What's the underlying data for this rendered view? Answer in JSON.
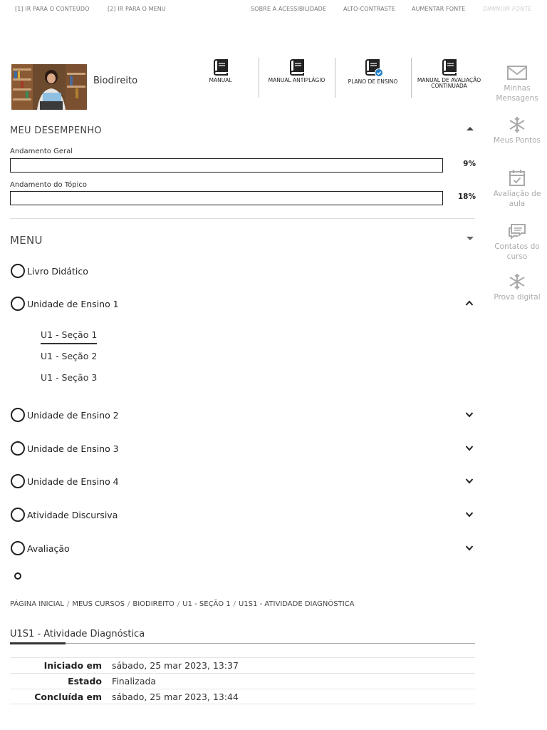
{
  "skip_links": [
    {
      "label": "[1] IR PARA O CONTEÚDO"
    },
    {
      "label": "[2] IR PARA O MENU"
    },
    {
      "label": "SOBRE A ACESSIBILIDADE"
    },
    {
      "label": "ALTO-CONTRASTE"
    },
    {
      "label": "AUMENTAR FONTE"
    },
    {
      "label": "DIMINUIR FONTE"
    }
  ],
  "course": {
    "title": "Biodireito"
  },
  "resources": [
    {
      "label": "MANUAL",
      "icon": "book-icon"
    },
    {
      "label": "MANUAL ANTIPLÁGIO",
      "icon": "book-icon"
    },
    {
      "label": "PLANO DE ENSINO",
      "icon": "book-check-icon"
    },
    {
      "label": "MANUAL DE AVALIAÇÃO CONTINUADA",
      "icon": "book-icon"
    }
  ],
  "sidenav": [
    {
      "label": "Minhas Mensagens",
      "icon": "envelope-icon"
    },
    {
      "label": "Meus Pontos",
      "icon": "snowflake-icon"
    },
    {
      "label": "Avaliação de aula",
      "icon": "calendar-check-icon"
    },
    {
      "label": "Contatos do curso",
      "icon": "chat-icon"
    },
    {
      "label": "Prova digital",
      "icon": "snowflake-icon"
    }
  ],
  "performance": {
    "title": "MEU DESEMPENHO",
    "items": [
      {
        "label": "Andamento Geral",
        "percent": 9,
        "percent_text": "9%"
      },
      {
        "label": "Andamento do Tópico",
        "percent": 18,
        "percent_text": "18%"
      }
    ]
  },
  "menu": {
    "title": "MENU",
    "items": [
      {
        "label": "Livro Didático",
        "expandable": false
      },
      {
        "label": "Unidade de Ensino 1",
        "expandable": true,
        "expanded": true
      },
      {
        "label": "Unidade de Ensino 2",
        "expandable": true,
        "expanded": false
      },
      {
        "label": "Unidade de Ensino 3",
        "expandable": true,
        "expanded": false
      },
      {
        "label": "Unidade de Ensino 4",
        "expandable": true,
        "expanded": false
      },
      {
        "label": "Atividade Discursiva",
        "expandable": true,
        "expanded": false
      },
      {
        "label": "Avaliação",
        "expandable": true,
        "expanded": false
      }
    ],
    "subitems": [
      {
        "label": "U1 - Seção 1",
        "active": true
      },
      {
        "label": "U1 - Seção 2",
        "active": false
      },
      {
        "label": "U1 - Seção 3",
        "active": false
      }
    ]
  },
  "breadcrumb": [
    "PÁGINA INICIAL",
    "MEUS CURSOS",
    "BIODIREITO",
    "U1 - SEÇÃO 1",
    "U1S1 - ATIVIDADE DIAGNÓSTICA"
  ],
  "activity": {
    "title": "U1S1 - Atividade Diagnóstica",
    "summary": [
      {
        "key": "Iniciado em",
        "value": "sábado, 25 mar 2023, 13:37"
      },
      {
        "key": "Estado",
        "value": "Finalizada"
      },
      {
        "key": "Concluída em",
        "value": "sábado, 25 mar 2023, 13:44"
      }
    ]
  },
  "colors": {
    "check_badge": "#1f7fc8"
  }
}
